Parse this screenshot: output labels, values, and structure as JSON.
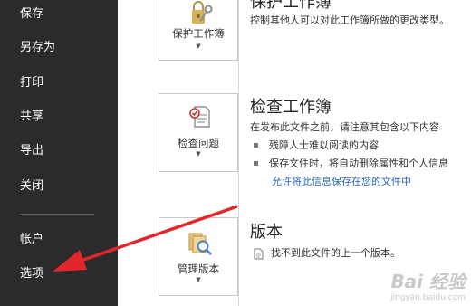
{
  "sidebar": {
    "items": [
      {
        "label": "保存"
      },
      {
        "label": "另存为"
      },
      {
        "label": "打印"
      },
      {
        "label": "共享"
      },
      {
        "label": "导出"
      },
      {
        "label": "关闭"
      },
      {
        "label": "帐户"
      },
      {
        "label": "选项"
      }
    ]
  },
  "sections": {
    "protect": {
      "title": "保护工作簿",
      "description": "控制其他人可以对此工作簿所做的更改类型。",
      "button_label": "保护工作簿",
      "icon": "lock-key-icon"
    },
    "inspect": {
      "title": "检查工作簿",
      "description": "在发布此文件之前，请注意其包含以下内容",
      "bullets": [
        "残障人士难以阅读的内容",
        "保存文件时，将自动删除属性和个人信息"
      ],
      "link": "允许将此信息保存在您的文件中",
      "button_label": "检查问题",
      "icon": "inspect-document-icon"
    },
    "versions": {
      "title": "版本",
      "description": "找不到此文件的上一个版本。",
      "button_label": "管理版本",
      "icon": "manage-versions-icon"
    }
  },
  "watermark": {
    "line1": "Bai 经验",
    "line2": "jingyan.baidu.com"
  },
  "colors": {
    "sidebar_bg": "#2b2b2b",
    "link": "#2b65b4",
    "arrow": "#e3262b"
  }
}
